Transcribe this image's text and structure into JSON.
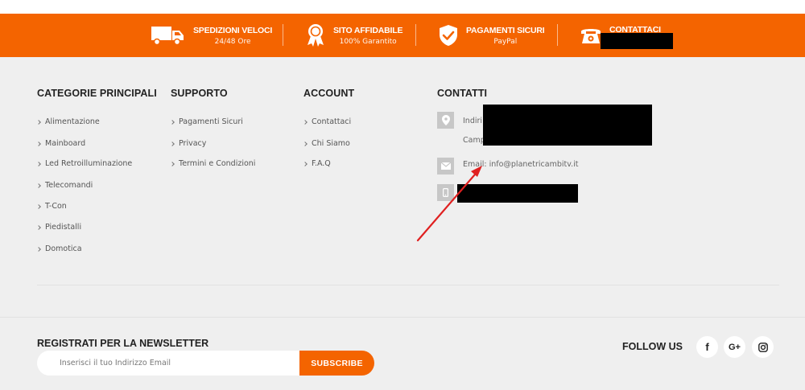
{
  "features": [
    {
      "title": "SPEDIZIONI VELOCI",
      "subtitle": "24/48 Ore",
      "icon": "truck-icon"
    },
    {
      "title": "SITO AFFIDABILE",
      "subtitle": "100% Garantito",
      "icon": "award-ribbon-icon"
    },
    {
      "title": "PAGAMENTI SICURI",
      "subtitle": "PayPal",
      "icon": "shield-check-icon"
    },
    {
      "title": "CONTATTACI",
      "subtitle": "",
      "icon": "telephone-icon"
    }
  ],
  "columns": [
    {
      "title": "CATEGORIE PRINCIPALI",
      "links": [
        "Alimentazione",
        "Mainboard",
        "Led Retroilluminazione",
        "Telecomandi",
        "T-Con",
        "Piedistalli",
        "Domotica"
      ]
    },
    {
      "title": "SUPPORTO",
      "links": [
        "Pagamenti Sicuri",
        "Privacy",
        "Termini e Condizioni"
      ]
    },
    {
      "title": "ACCOUNT",
      "links": [
        "Contattaci",
        "Chi Siamo",
        "F.A.Q"
      ]
    }
  ],
  "contacts": {
    "title": "CONTATTI",
    "address_line1": "Indiri",
    "address_line2": "Camp",
    "email": "Email: info@planetricambitv.it"
  },
  "newsletter": {
    "title": "REGISTRATI PER LA NEWSLETTER",
    "placeholder": "Inserisci il tuo Indirizzo Email",
    "button": "SUBSCRIBE"
  },
  "social": {
    "title": "FOLLOW US",
    "items": [
      {
        "label": "f",
        "icon": "facebook-icon"
      },
      {
        "label": "G+",
        "icon": "google-plus-icon"
      },
      {
        "label": "",
        "icon": "instagram-icon"
      }
    ]
  },
  "colors": {
    "accent": "#f46400",
    "background": "#efefef",
    "annotation_arrow": "#e02020"
  }
}
